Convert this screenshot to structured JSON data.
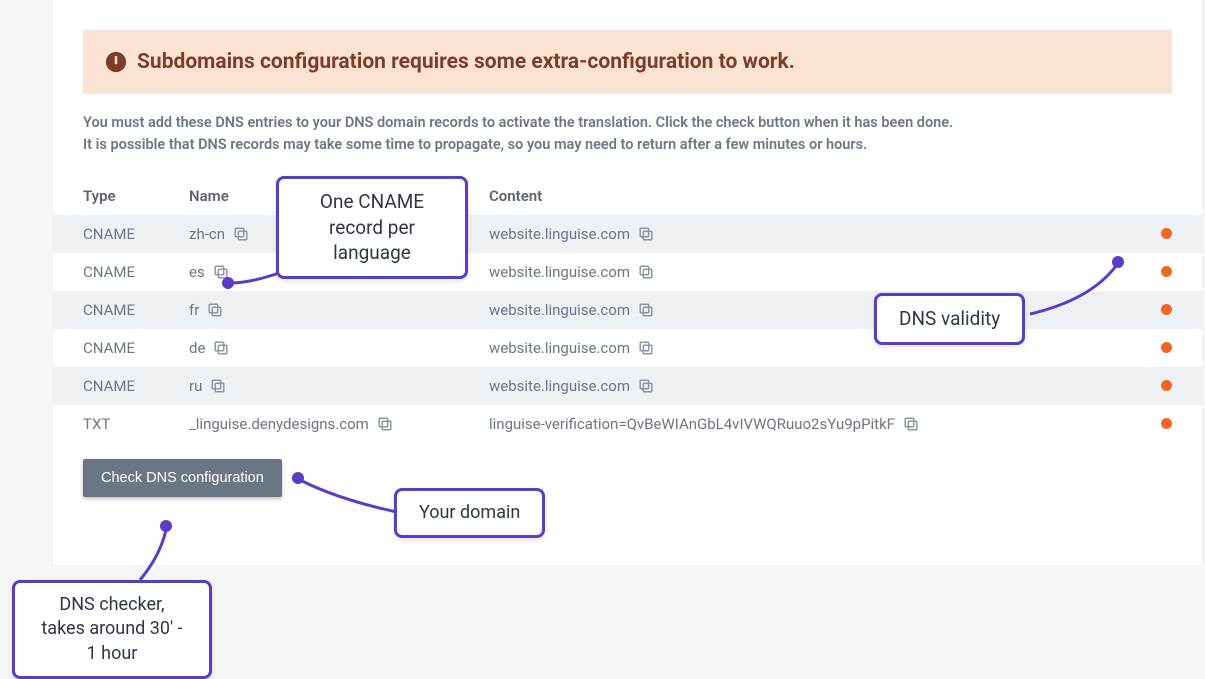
{
  "alert": {
    "text": "Subdomains configuration requires some extra-configuration to work."
  },
  "hint": {
    "line1": "You must add these DNS entries to your DNS domain records to activate the translation. Click the check button when it has been done.",
    "line2": "It is possible that DNS records may take some time to propagate, so you may need to return after a few minutes or hours."
  },
  "table": {
    "headers": {
      "type": "Type",
      "name": "Name",
      "content": "Content"
    },
    "rows": [
      {
        "type": "CNAME",
        "name": "zh-cn",
        "content": "website.linguise.com",
        "stripe": true
      },
      {
        "type": "CNAME",
        "name": "es",
        "content": "website.linguise.com",
        "stripe": false
      },
      {
        "type": "CNAME",
        "name": "fr",
        "content": "website.linguise.com",
        "stripe": true
      },
      {
        "type": "CNAME",
        "name": "de",
        "content": "website.linguise.com",
        "stripe": false
      },
      {
        "type": "CNAME",
        "name": "ru",
        "content": "website.linguise.com",
        "stripe": true
      },
      {
        "type": "TXT",
        "name": "_linguise.denydesigns.com",
        "content": "linguise-verification=QvBeWIAnGbL4vIVWQRuuo2sYu9pPitkF",
        "stripe": false
      }
    ]
  },
  "button": {
    "label": "Check DNS configuration"
  },
  "callouts": {
    "cname": "One CNAME record per language",
    "validity": "DNS validity",
    "domain": "Your domain",
    "checker": "DNS checker, takes around 30' - 1 hour"
  },
  "colors": {
    "accent": "#5b3cc4",
    "status": "#f26522",
    "alertBg": "#fbe3d3",
    "alertFg": "#7c3e2b"
  }
}
